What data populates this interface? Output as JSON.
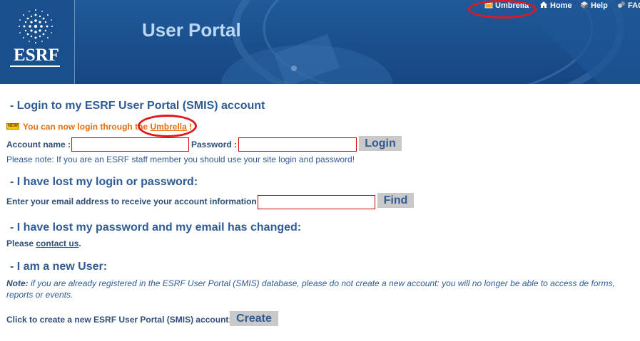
{
  "header": {
    "logo_text": "ESRF",
    "title": "User Portal",
    "nav": [
      {
        "label": "Umbrella",
        "icon": "umbrella-icon"
      },
      {
        "label": "Home",
        "icon": "home-icon"
      },
      {
        "label": "Help",
        "icon": "help-icon"
      },
      {
        "label": "FAQ",
        "icon": "faq-icon"
      }
    ]
  },
  "login": {
    "heading": "- Login to my ESRF User Portal (SMIS) account",
    "new_badge": "NEW",
    "umbrella_prefix": "You can now login through the ",
    "umbrella_link": "Umbrella",
    "umbrella_suffix": " !",
    "account_label": "Account name :",
    "account_value": "",
    "password_label": "Password :",
    "password_value": "",
    "login_button": "Login",
    "staff_note": "Please note: If you are an ESRF staff member you should use your site login and password!"
  },
  "lost": {
    "heading": "- I have lost my login or password:",
    "email_label": "Enter your email address to receive your account information:",
    "email_value": "",
    "find_button": "Find"
  },
  "changed": {
    "heading": "- I have lost my password and my email has changed:",
    "prefix": "Please ",
    "link": "contact us",
    "suffix": "."
  },
  "new_user": {
    "heading": "- I am a new User:",
    "note_label": "Note:",
    "note_text": " if you are already registered in the ESRF User Portal (SMIS) database, please do not create a new account: you will no longer be able to access de forms, reports or events.",
    "create_label": "Click to create a new ESRF User Portal (SMIS) account:",
    "create_button": "Create"
  },
  "colors": {
    "header_blue": "#1b4f8c",
    "title_light_blue": "#b9d8f7",
    "heading_blue": "#2f5b94",
    "umbrella_orange": "#e56d0e",
    "annotation_red": "#e3171d",
    "field_border_red": "#d80000",
    "button_gray": "#c9c9c9"
  }
}
